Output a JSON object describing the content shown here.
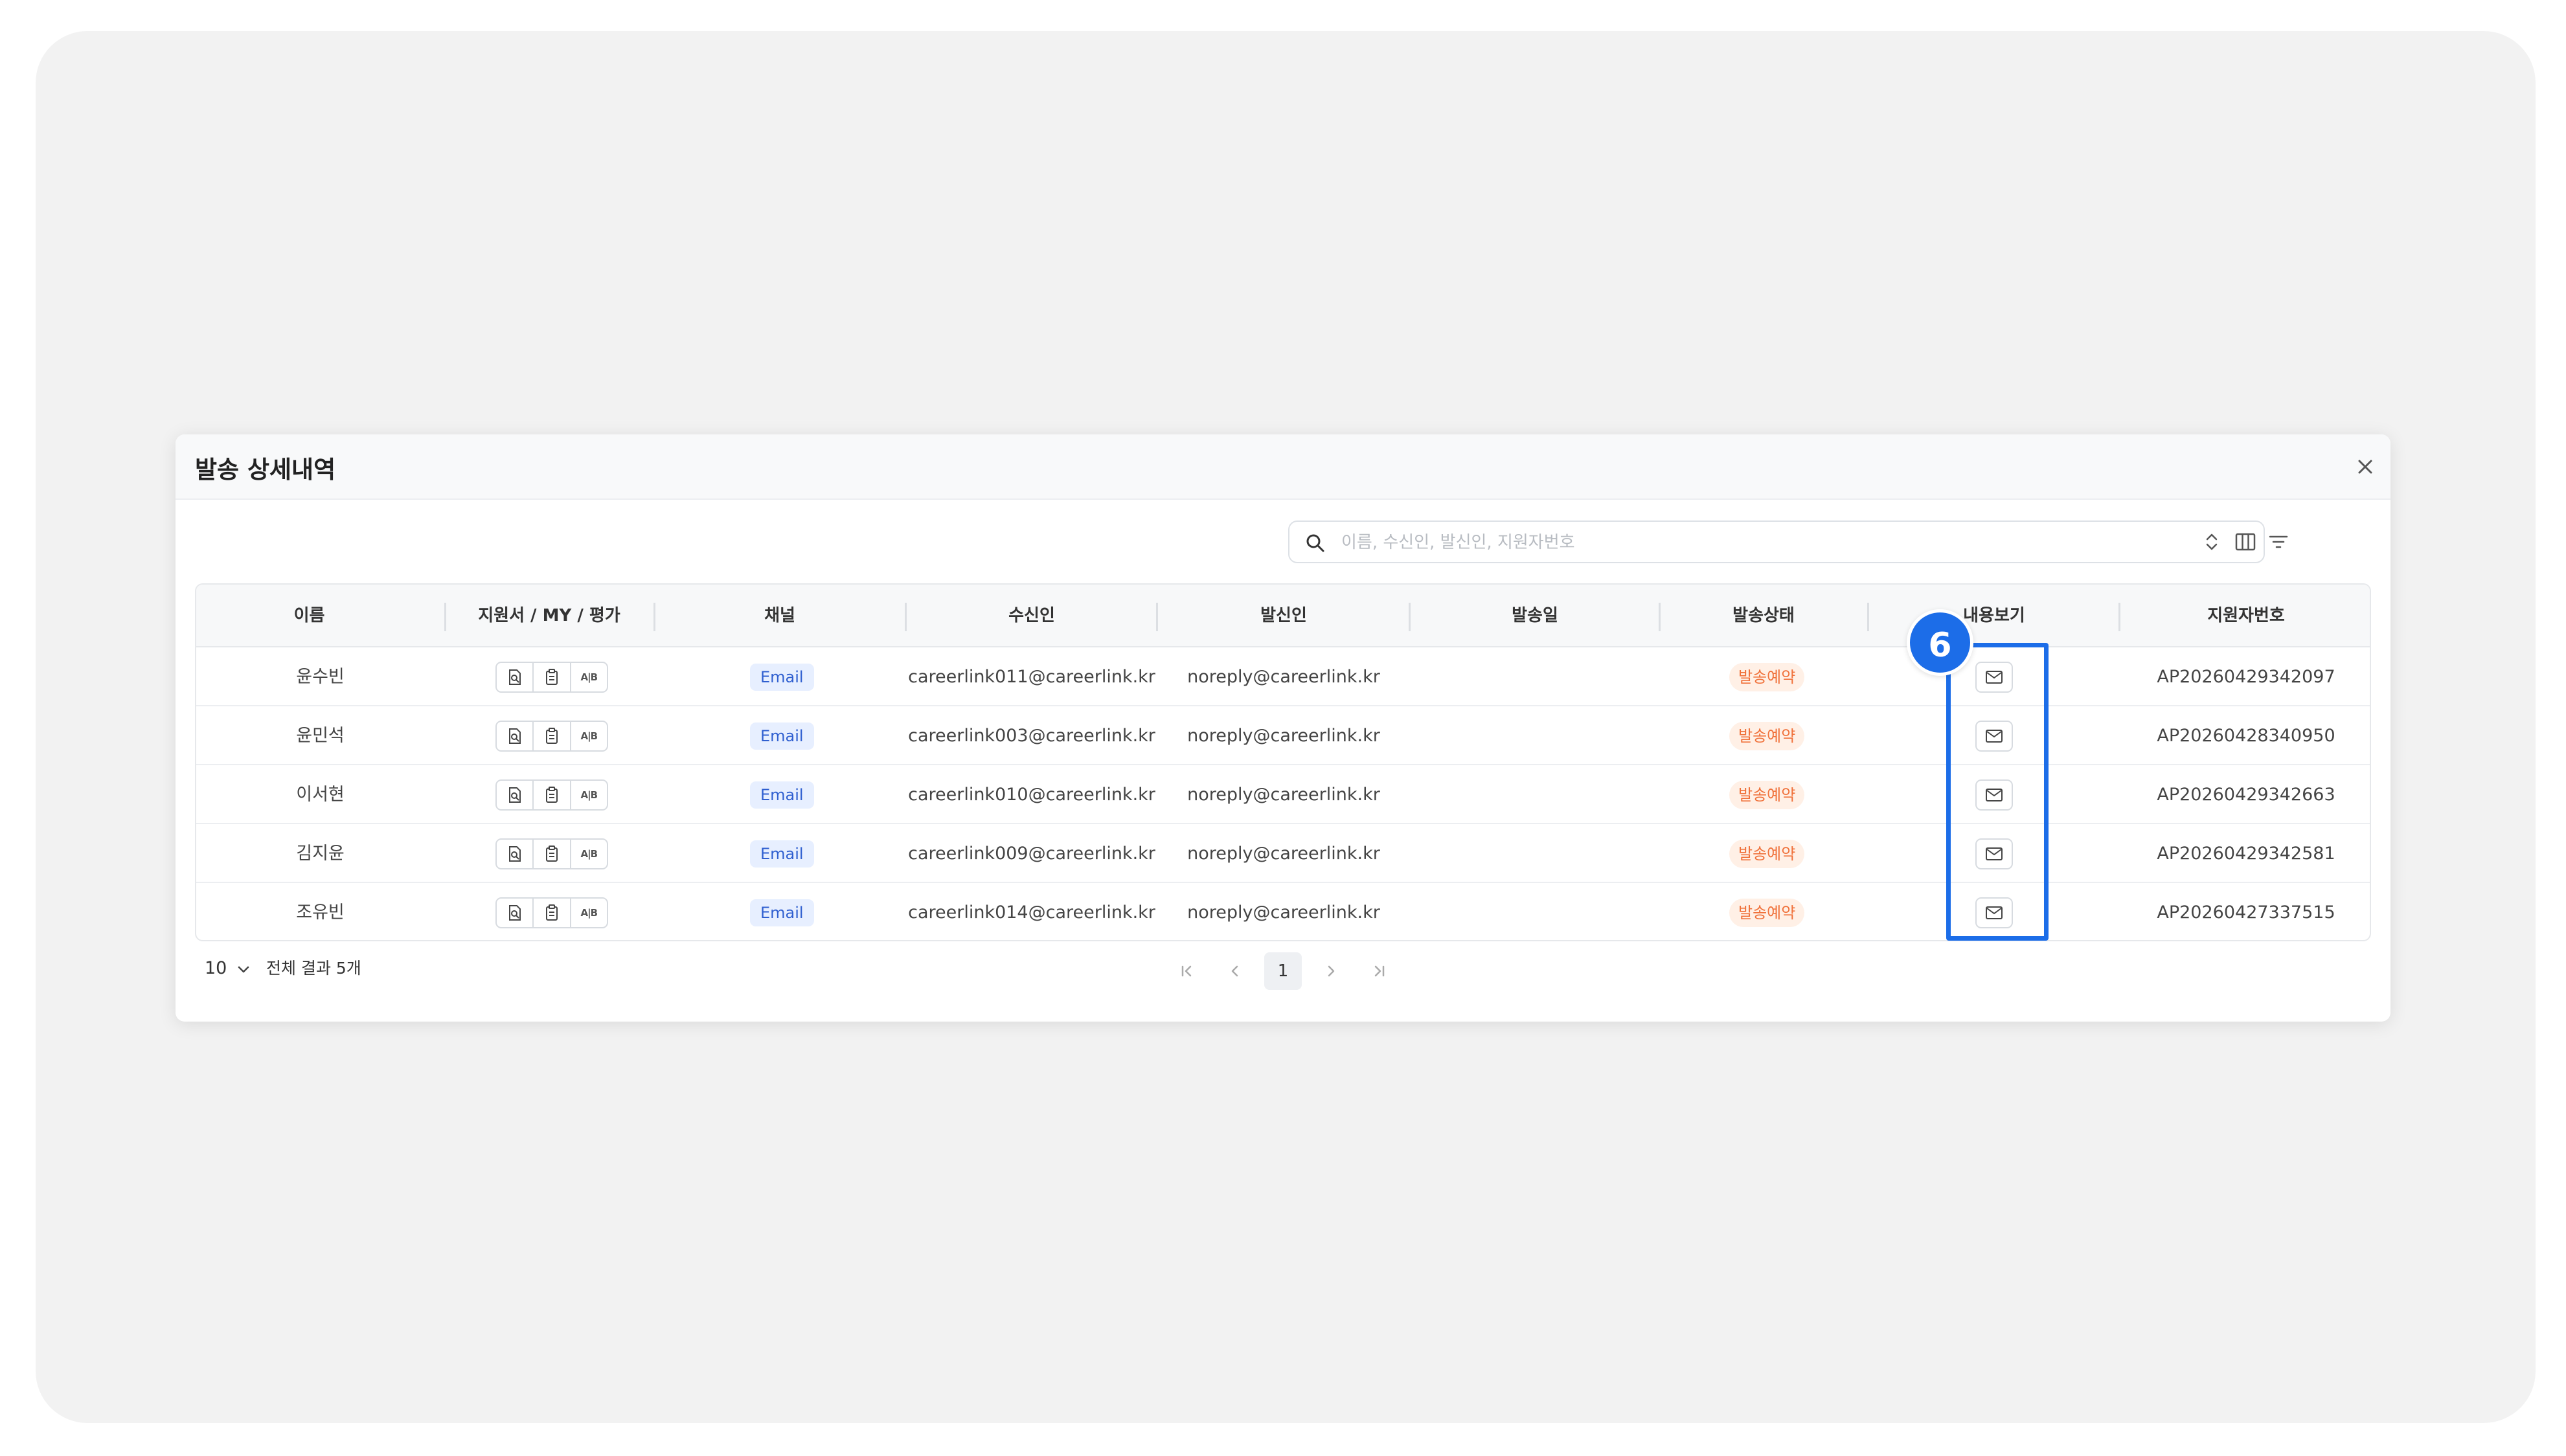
{
  "dialog": {
    "title": "발송 상세내역",
    "close_icon": "close-icon"
  },
  "search": {
    "placeholder": "이름, 수신인, 발신인, 지원자번호",
    "icon": "search-icon"
  },
  "toolbar": {
    "icons": [
      "sort-icon",
      "columns-icon",
      "filter-icon"
    ]
  },
  "table": {
    "headers": [
      "이름",
      "지원서 / MY / 평가",
      "채널",
      "수신인",
      "발신인",
      "발송일",
      "발송상태",
      "내용보기",
      "지원자번호"
    ],
    "rows": [
      {
        "name": "윤수빈",
        "channel": "Email",
        "recipient": "careerlink011@careerlink.kr",
        "sender": "noreply@careerlink.kr",
        "sent_date": "",
        "status": "발송예약",
        "applicant_no": "AP20260429342097"
      },
      {
        "name": "윤민석",
        "channel": "Email",
        "recipient": "careerlink003@careerlink.kr",
        "sender": "noreply@careerlink.kr",
        "sent_date": "",
        "status": "발송예약",
        "applicant_no": "AP20260428340950"
      },
      {
        "name": "이서현",
        "channel": "Email",
        "recipient": "careerlink010@careerlink.kr",
        "sender": "noreply@careerlink.kr",
        "sent_date": "",
        "status": "발송예약",
        "applicant_no": "AP20260429342663"
      },
      {
        "name": "김지윤",
        "channel": "Email",
        "recipient": "careerlink009@careerlink.kr",
        "sender": "noreply@careerlink.kr",
        "sent_date": "",
        "status": "발송예약",
        "applicant_no": "AP20260429342581"
      },
      {
        "name": "조유빈",
        "channel": "Email",
        "recipient": "careerlink014@careerlink.kr",
        "sender": "noreply@careerlink.kr",
        "sent_date": "",
        "status": "발송예약",
        "applicant_no": "AP20260427337515"
      }
    ],
    "row_icons": [
      "application-view-icon",
      "clipboard-icon",
      "ab-eval-icon"
    ],
    "ab_label": "A|B",
    "view_icon": "mail-icon"
  },
  "footer": {
    "page_size": "10",
    "total_text": "전체 결과 5개"
  },
  "pagination": {
    "current_page": "1",
    "icons": [
      "first-page-icon",
      "prev-page-icon",
      "next-page-icon",
      "last-page-icon"
    ]
  },
  "annotation": {
    "step_number": "6"
  },
  "colors": {
    "accent_blue": "#1c6de8",
    "channel_badge_bg": "#e7efff",
    "channel_badge_text": "#2f5fd0",
    "status_badge_bg": "#fff0e6",
    "status_badge_text": "#f0713a"
  }
}
